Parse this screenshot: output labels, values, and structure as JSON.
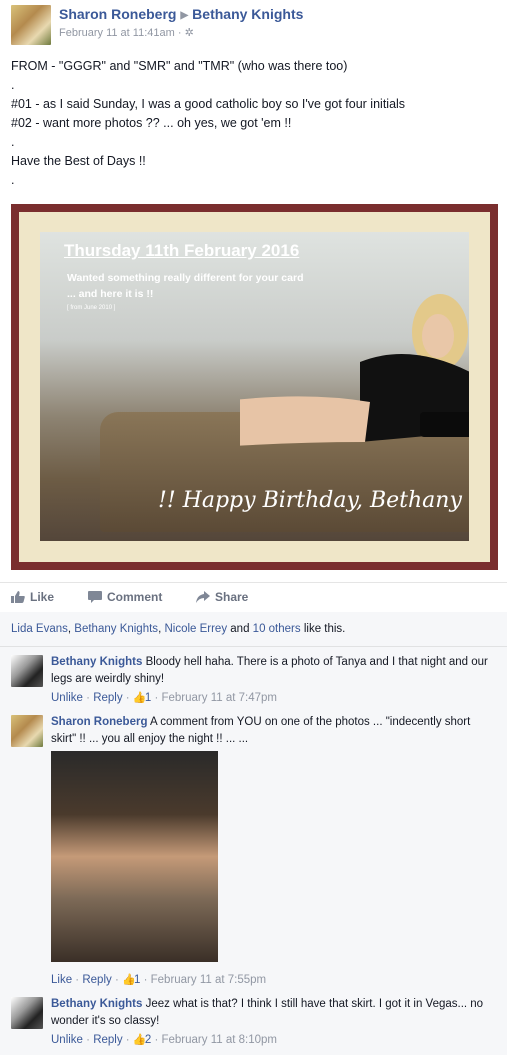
{
  "post": {
    "author": "Sharon Roneberg",
    "target": "Bethany Knights",
    "timestamp": "February 11 at 11:41am",
    "lines": [
      "FROM - \"GGGR\" and \"SMR\" and \"TMR\" (who was there too)",
      ".",
      "#01 - as I said Sunday, I was a good catholic boy so I've got four initials",
      "#02 - want more photos ?? ... oh yes, we got 'em !!",
      ".",
      "Have the Best of Days !!",
      "."
    ],
    "photo": {
      "title": "Thursday 11th February 2016",
      "sub1": "Wanted something really different for your card",
      "sub2": "... and here it is !!",
      "sub3": "[ from June 2010 ]",
      "greeting": "!! Happy Birthday, Bethany !!"
    }
  },
  "actions": {
    "like": "Like",
    "comment": "Comment",
    "share": "Share"
  },
  "likes": {
    "names": [
      "Lida Evans",
      "Bethany Knights",
      "Nicole Errey"
    ],
    "others": "10 others",
    "suffix": "like this."
  },
  "comments": [
    {
      "author": "Bethany Knights",
      "text": "Bloody hell haha. There is a photo of Tanya and I that night and our legs are weirdly shiny!",
      "action": "Unlike",
      "reply": "Reply",
      "likes": "1",
      "time": "February 11 at 7:47pm"
    },
    {
      "author": "Sharon Roneberg",
      "text": "A comment from YOU on one of the photos ... \"indecently short skirt\" !! ... you all enjoy the night !! ... ...",
      "action": "Like",
      "reply": "Reply",
      "likes": "1",
      "time": "February 11 at 7:55pm"
    },
    {
      "author": "Bethany Knights",
      "text": "Jeez what is that? I think I still have that skirt. I got it in Vegas... no wonder it's so classy!",
      "action": "Unlike",
      "reply": "Reply",
      "likes": "2",
      "time": "February 11 at 8:10pm"
    }
  ],
  "colors": {
    "link": "#3b5998",
    "meta": "#9197a3",
    "frame": "#7a2e2e"
  }
}
